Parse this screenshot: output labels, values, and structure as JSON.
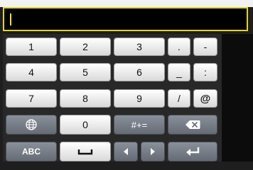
{
  "input": {
    "value": ""
  },
  "keys": {
    "r1": [
      "1",
      "2",
      "3",
      ".",
      "-"
    ],
    "r2": [
      "4",
      "5",
      "6",
      "_",
      ":"
    ],
    "r3": [
      "7",
      "8",
      "9",
      "/",
      "@"
    ],
    "r4": {
      "zero": "0",
      "symbols": "#+="
    },
    "r5": {
      "abc": "ABC"
    }
  },
  "icons": {
    "globe": "globe-icon",
    "backspace": "backspace-icon",
    "space": "space-icon",
    "left": "arrow-left-icon",
    "right": "arrow-right-icon",
    "enter": "enter-icon"
  },
  "colors": {
    "accent": "#e4d61a",
    "keyboard_bg": "#282828",
    "function_key": "#7a8089"
  }
}
